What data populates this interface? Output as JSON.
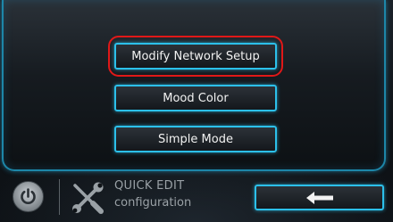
{
  "menu": {
    "items": [
      {
        "label": "Modify Network Setup",
        "selected": true
      },
      {
        "label": "Mood Color",
        "selected": false
      },
      {
        "label": "Simple Mode",
        "selected": false
      }
    ]
  },
  "footer": {
    "power_icon": "power-icon",
    "tools_icon": "wrench-screwdriver-icon",
    "title": "QUICK EDIT",
    "subtitle": "configuration",
    "back_icon": "left-arrow-icon"
  },
  "colors": {
    "accent": "#2cc0ea",
    "selection": "#e01818",
    "text": "#f2f2f2",
    "muted": "#9aa1a6"
  }
}
